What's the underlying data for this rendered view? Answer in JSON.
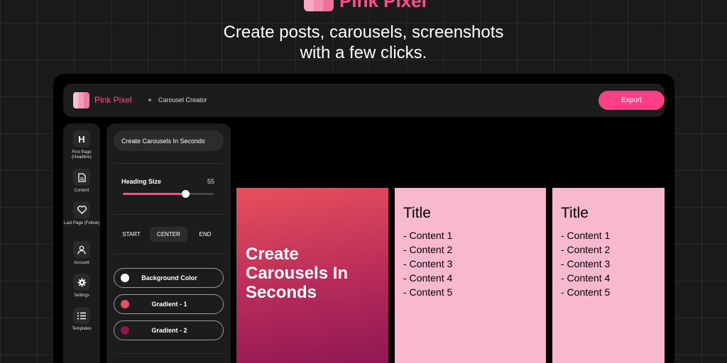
{
  "brand": {
    "name": "Pink Pixel",
    "tagline_line1": "Create posts, carousels, screenshots",
    "tagline_line2": "with a few clicks."
  },
  "topbar": {
    "app_name": "Pink Pixel",
    "page_name": "Carousel Creator",
    "export_label": "Export"
  },
  "sidebar": {
    "items": [
      {
        "icon": "H",
        "label": "First Page (Headline)"
      },
      {
        "icon": "document-icon",
        "label": "Content"
      },
      {
        "icon": "heart-icon",
        "label": "Last Page (Follow)"
      },
      {
        "icon": "user-icon",
        "label": "Account"
      },
      {
        "icon": "gear-icon",
        "label": "Settings"
      },
      {
        "icon": "list-icon",
        "label": "Templates"
      }
    ]
  },
  "panel": {
    "headline_value": "Create Carousels In Seconds",
    "heading_size_label": "Heading Size",
    "heading_size_value": "55",
    "heading_size_fraction": 0.69,
    "align": {
      "start": "START",
      "center": "CENTER",
      "end": "END",
      "selected": "CENTER"
    },
    "colors": [
      {
        "label": "Background Color",
        "swatch": "#ffffff"
      },
      {
        "label": "Gradient - 1",
        "swatch": "#e8505b"
      },
      {
        "label": "Gradient - 2",
        "swatch": "#8c1552"
      }
    ]
  },
  "slides": {
    "first": {
      "headline": "Create Carousels In Seconds",
      "arrow": "→"
    },
    "content": {
      "title": "Title",
      "items": [
        "- Content 1",
        "- Content 2",
        "- Content 3",
        "- Content 4",
        "- Content 5"
      ],
      "arrow": "→"
    }
  },
  "colors": {
    "accent": "#ff3f86",
    "slide_pink": "#f8b8d0",
    "panel_bg": "#1c1c1c"
  }
}
